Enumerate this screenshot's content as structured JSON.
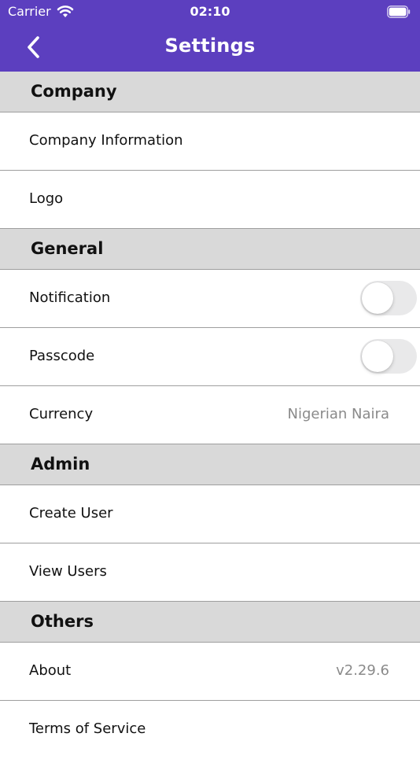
{
  "status_bar": {
    "carrier": "Carrier",
    "time": "02:10"
  },
  "nav": {
    "title": "Settings",
    "back_icon": "chevron-left-icon"
  },
  "colors": {
    "header_bg": "#5c3fbf",
    "section_bg": "#d9d9d9",
    "value_text": "#8a8a8a"
  },
  "sections": {
    "company": {
      "title": "Company",
      "items": [
        {
          "label": "Company Information"
        },
        {
          "label": "Logo"
        }
      ]
    },
    "general": {
      "title": "General",
      "items": [
        {
          "label": "Notification",
          "toggle": "off"
        },
        {
          "label": "Passcode",
          "toggle": "off"
        },
        {
          "label": "Currency",
          "value": "Nigerian Naira"
        }
      ]
    },
    "admin": {
      "title": "Admin",
      "items": [
        {
          "label": "Create User"
        },
        {
          "label": "View Users"
        }
      ]
    },
    "others": {
      "title": "Others",
      "items": [
        {
          "label": "About",
          "value": "v2.29.6"
        },
        {
          "label": "Terms of Service"
        }
      ]
    }
  }
}
